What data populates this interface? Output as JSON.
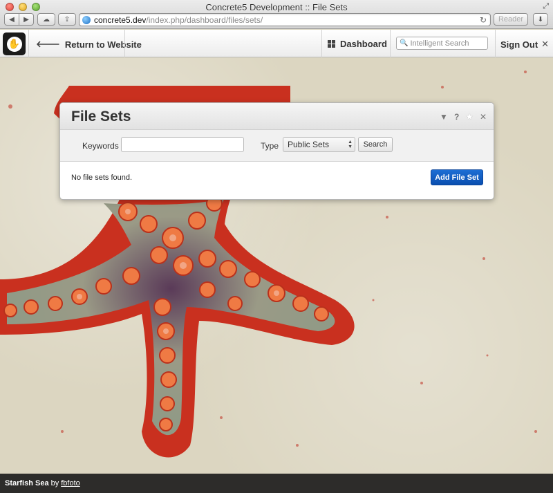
{
  "window": {
    "title": "Concrete5 Development :: File Sets",
    "url_host": "concrete5.dev",
    "url_path": "/index.php/dashboard/files/sets/",
    "reader_label": "Reader"
  },
  "toolbar": {
    "return_label": "Return to Website",
    "dashboard_label": "Dashboard",
    "search_placeholder": "Intelligent Search",
    "signout_label": "Sign Out"
  },
  "panel": {
    "title": "File Sets",
    "help_label": "?",
    "keywords_label": "Keywords",
    "keywords_value": "",
    "type_label": "Type",
    "type_selected": "Public Sets",
    "search_button": "Search",
    "empty_message": "No file sets found.",
    "add_button": "Add File Set"
  },
  "credit": {
    "title": "Starfish Sea",
    "by": "by",
    "author": "fbfoto"
  },
  "colors": {
    "accent_button": "#0a5bc4",
    "starfish_red": "#d8331f",
    "starfish_orange": "#f07a45",
    "sand": "#dcd6c1"
  }
}
